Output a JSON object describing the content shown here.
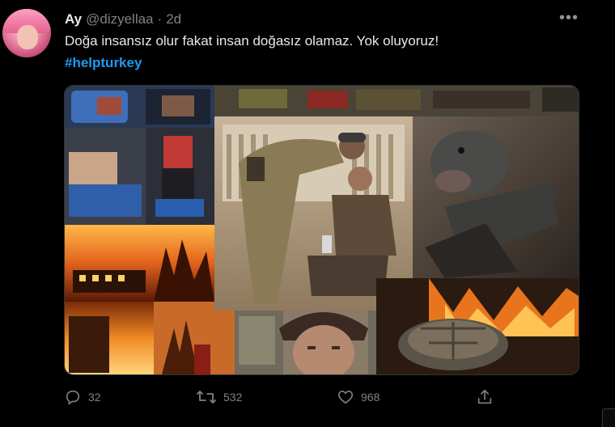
{
  "author": {
    "display_name": "Ay",
    "handle": "@dizyellaa",
    "separator": "·",
    "time": "2d"
  },
  "tweet": {
    "text": "Doğa insansız olur fakat insan doğasız olamaz. Yok oluyoruz!",
    "hashtag": "#helpturkey"
  },
  "media": {
    "description_tiles": [
      "injured-people",
      "forest-fire",
      "soldier-helping-man",
      "burned-animal",
      "burning-town",
      "young-man",
      "tortoise-in-fire"
    ]
  },
  "actions": {
    "reply_count": "32",
    "retweet_count": "532",
    "like_count": "968"
  },
  "more_label": "•••"
}
